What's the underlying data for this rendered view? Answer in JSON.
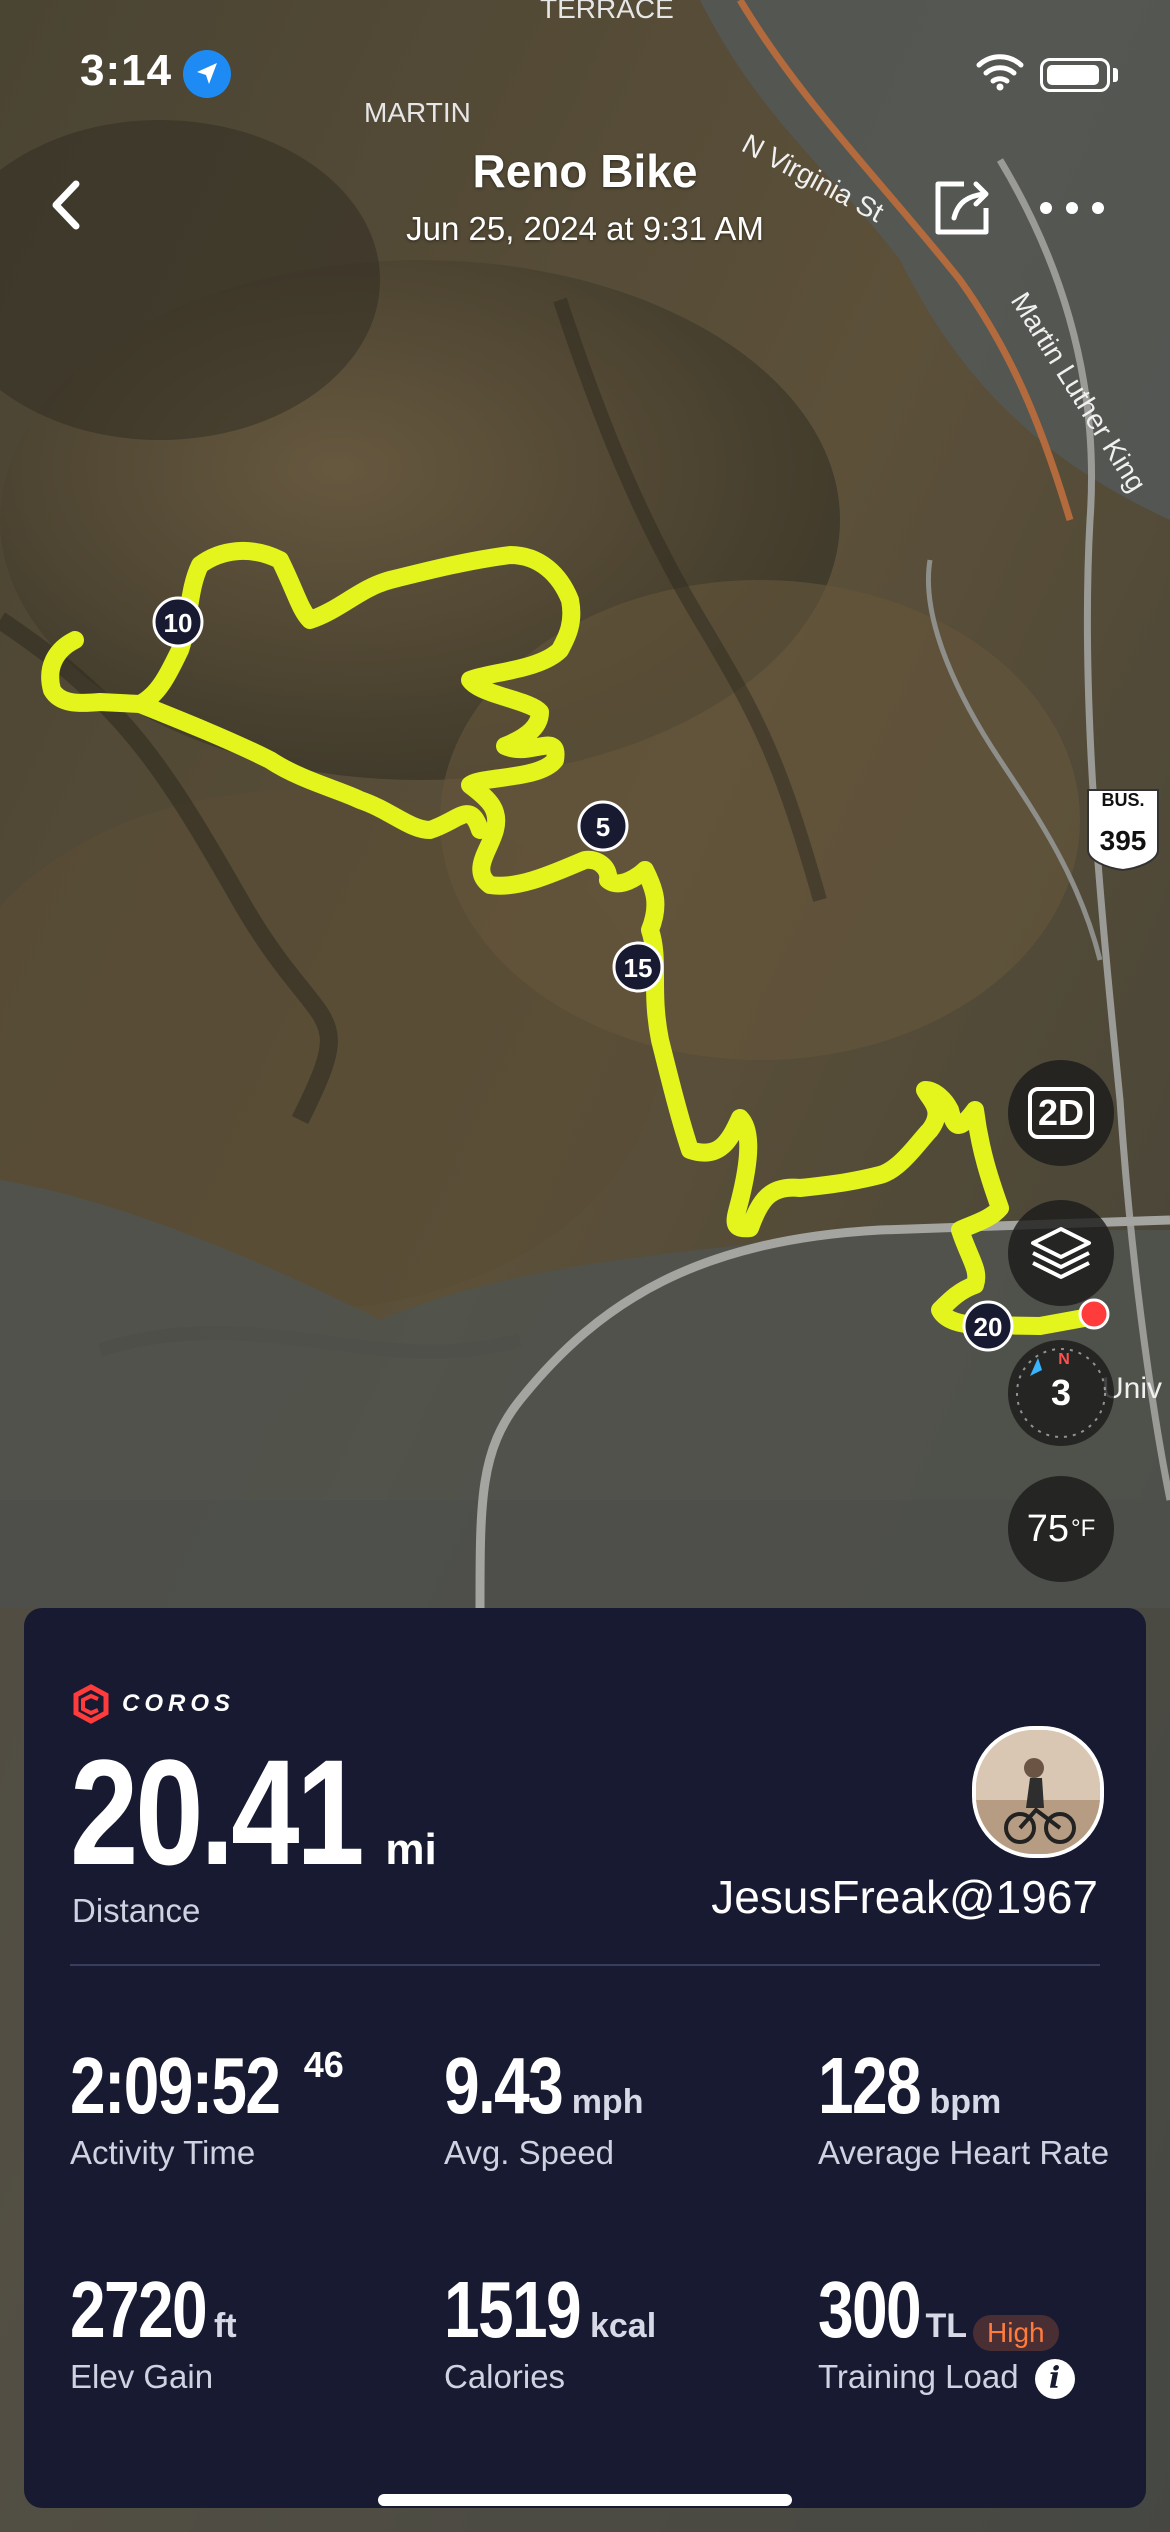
{
  "status_bar": {
    "time": "3:14"
  },
  "header": {
    "title": "Reno Bike",
    "subtitle": "Jun 25, 2024 at 9:31 AM"
  },
  "map": {
    "labels": {
      "terrace": "TERRACE",
      "martin": "MARTIN",
      "n_virginia": "N Virginia St",
      "mlk": "Martin Luther King",
      "hwy_bus": "BUS.",
      "hwy_num": "395",
      "univ": "Univ"
    },
    "markers": [
      "10",
      "5",
      "15",
      "20"
    ],
    "route_color": "#e3f51c"
  },
  "controls": {
    "view_mode": "2D",
    "compass_value": "3",
    "compass_north": "N",
    "temperature": "75",
    "temperature_unit": "°F"
  },
  "summary": {
    "brand": "COROS",
    "distance": {
      "value": "20.41",
      "unit": "mi",
      "label": "Distance"
    },
    "username": "JesusFreak@1967",
    "stats": [
      {
        "value": "2:09:52",
        "sup": "46",
        "unit": "",
        "label": "Activity Time"
      },
      {
        "value": "9.43",
        "unit": "mph",
        "label": "Avg. Speed"
      },
      {
        "value": "128",
        "unit": "bpm",
        "label": "Average Heart Rate"
      },
      {
        "value": "2720",
        "unit": "ft",
        "label": "Elev Gain"
      },
      {
        "value": "1519",
        "unit": "kcal",
        "label": "Calories"
      },
      {
        "value": "300",
        "unit": "TL",
        "badge": "High",
        "label": "Training Load"
      }
    ]
  },
  "colors": {
    "card_bg": "#171a31",
    "route": "#e3f51c",
    "badge_high": "#ff7a3d",
    "location_dot": "#ff3b3b",
    "gps_badge": "#1e8bf5"
  }
}
